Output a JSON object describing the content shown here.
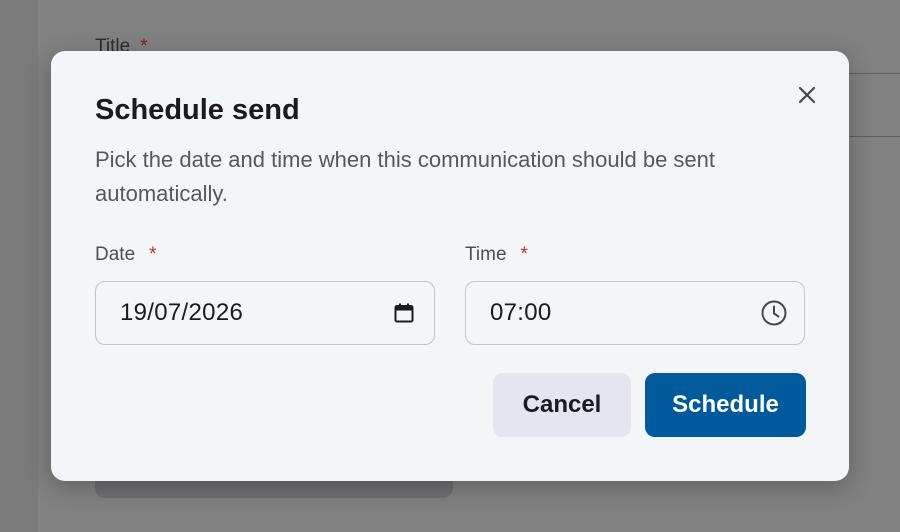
{
  "background": {
    "title_label": "Title",
    "required_mark": "*"
  },
  "dialog": {
    "title": "Schedule send",
    "description": "Pick the date and time when this communication should be sent automatically.",
    "close_icon": "close-icon",
    "date": {
      "label": "Date",
      "required_mark": "*",
      "value": "19/07/2026",
      "icon": "calendar-icon"
    },
    "time": {
      "label": "Time",
      "required_mark": "*",
      "value": "07:00",
      "icon": "clock-icon"
    },
    "buttons": {
      "cancel_label": "Cancel",
      "schedule_label": "Schedule"
    }
  },
  "colors": {
    "primary": "#005a9c",
    "required": "#c0302b",
    "cancel_bg": "#e4e5ef",
    "dialog_bg": "#f2f6f8"
  }
}
